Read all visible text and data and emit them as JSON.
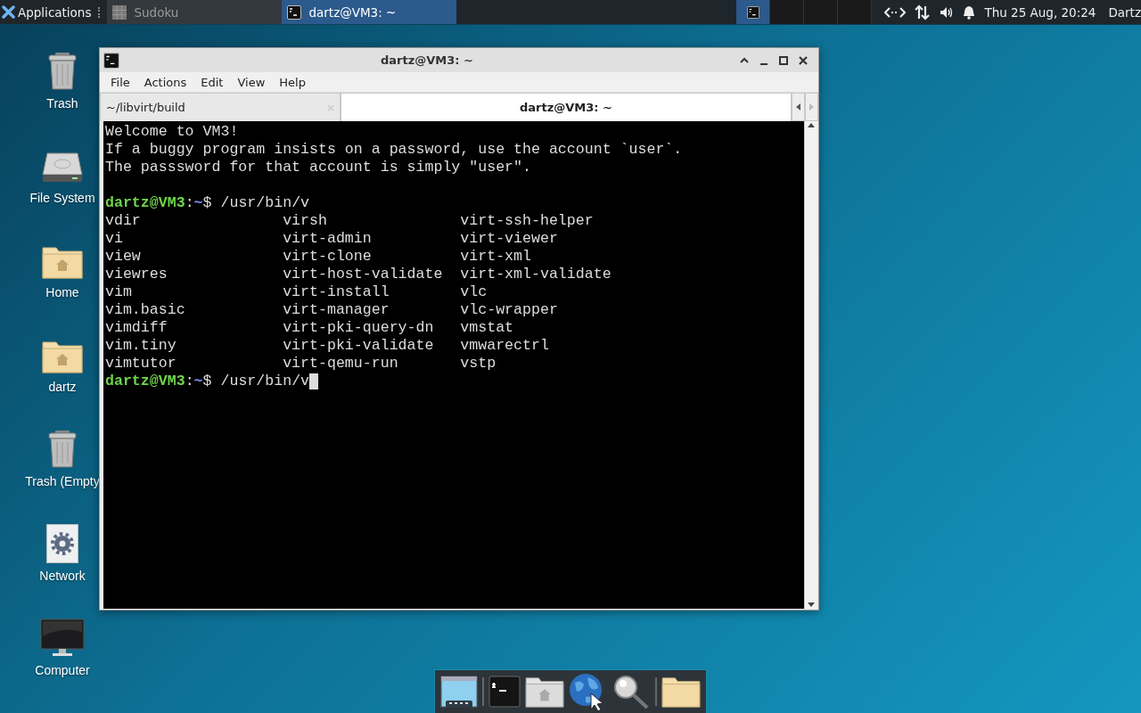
{
  "panel": {
    "app_menu": "Applications",
    "tasks": [
      {
        "title": "Sudoku",
        "selected": false
      },
      {
        "title": "dartz@VM3: ~",
        "selected": true
      }
    ],
    "workspaces": [
      {
        "selected": true
      },
      {
        "selected": false
      },
      {
        "selected": false
      },
      {
        "selected": false
      }
    ],
    "clock": "Thu 25 Aug, 20:24",
    "user": "Dartz"
  },
  "desktop_icons": [
    {
      "kind": "trash",
      "label": "Trash"
    },
    {
      "kind": "drive",
      "label": "File System"
    },
    {
      "kind": "home",
      "label": "Home"
    },
    {
      "kind": "home",
      "label": "dartz"
    },
    {
      "kind": "trash",
      "label": "Trash (Empty"
    },
    {
      "kind": "network",
      "label": "Network"
    },
    {
      "kind": "computer",
      "label": "Computer"
    }
  ],
  "window": {
    "title": "dartz@VM3: ~",
    "menu": [
      "File",
      "Actions",
      "Edit",
      "View",
      "Help"
    ],
    "tabs": [
      {
        "label": "~/libvirt/build",
        "selected": false
      },
      {
        "label": "dartz@VM3: ~",
        "selected": true
      }
    ],
    "terminal": [
      {
        "kind": "text",
        "text": "Welcome to VM3!"
      },
      {
        "kind": "text",
        "text": "If a buggy program insists on a password, use the account `user`."
      },
      {
        "kind": "text",
        "text": "The passsword for that account is simply \"user\"."
      },
      {
        "kind": "blank"
      },
      {
        "kind": "prompt",
        "user": "dartz@VM3",
        "separator": ":",
        "path": "~",
        "symbol": "$",
        "command": "/usr/bin/v",
        "cursor": false
      },
      {
        "kind": "columns",
        "rows": [
          [
            "vdir",
            "virsh",
            "virt-ssh-helper"
          ],
          [
            "vi",
            "virt-admin",
            "virt-viewer"
          ],
          [
            "view",
            "virt-clone",
            "virt-xml"
          ],
          [
            "viewres",
            "virt-host-validate",
            "virt-xml-validate"
          ],
          [
            "vim",
            "virt-install",
            "vlc"
          ],
          [
            "vim.basic",
            "virt-manager",
            "vlc-wrapper"
          ],
          [
            "vimdiff",
            "virt-pki-query-dn",
            "vmstat"
          ],
          [
            "vim.tiny",
            "virt-pki-validate",
            "vmwarectrl"
          ],
          [
            "vimtutor",
            "virt-qemu-run",
            "vstp"
          ]
        ]
      },
      {
        "kind": "prompt",
        "user": "dartz@VM3",
        "separator": ":",
        "path": "~",
        "symbol": "$",
        "command": "/usr/bin/v",
        "cursor": true
      }
    ]
  },
  "dock": [
    {
      "kind": "desktop"
    },
    {
      "kind": "separator"
    },
    {
      "kind": "terminal"
    },
    {
      "kind": "home"
    },
    {
      "kind": "globe"
    },
    {
      "kind": "search"
    },
    {
      "kind": "separator"
    },
    {
      "kind": "folder"
    }
  ]
}
